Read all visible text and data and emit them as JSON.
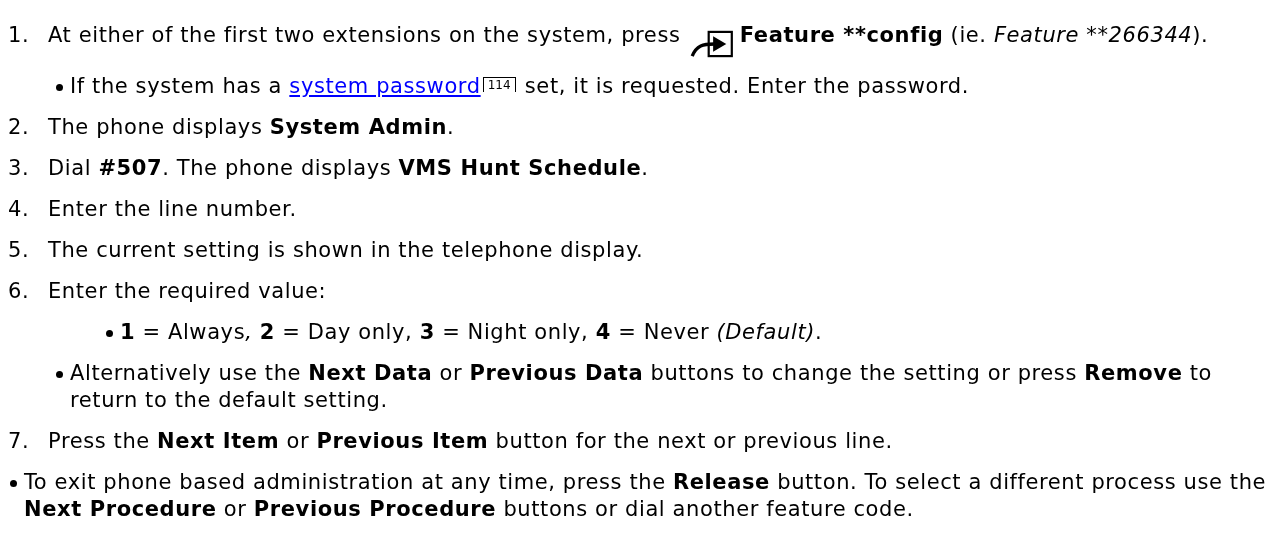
{
  "items": [
    {
      "kind": "step",
      "number": "1.",
      "segments": [
        {
          "kind": "plain",
          "text": "At either of the first two extensions on the system, press "
        },
        {
          "kind": "icon"
        },
        {
          "kind": "bold",
          "text": "Feature **config"
        },
        {
          "kind": "plain",
          "text": " (ie. "
        },
        {
          "kind": "italic",
          "text": "Feature **266344"
        },
        {
          "kind": "plain",
          "text": ")."
        }
      ],
      "children": [
        {
          "kind": "bullet",
          "segments": [
            {
              "kind": "plain",
              "text": "If the system has a "
            },
            {
              "kind": "link",
              "text": "system password"
            },
            {
              "kind": "pageref",
              "text": "114"
            },
            {
              "kind": "plain",
              "text": " set, it is requested. Enter the password."
            }
          ]
        }
      ]
    },
    {
      "kind": "step",
      "number": "2.",
      "segments": [
        {
          "kind": "plain",
          "text": "The phone displays "
        },
        {
          "kind": "bold",
          "text": "System Admin"
        },
        {
          "kind": "plain",
          "text": "."
        }
      ]
    },
    {
      "kind": "step",
      "number": "3.",
      "segments": [
        {
          "kind": "plain",
          "text": "Dial "
        },
        {
          "kind": "bold",
          "text": "#507"
        },
        {
          "kind": "plain",
          "text": ". The phone displays "
        },
        {
          "kind": "bold",
          "text": "VMS Hunt Schedule"
        },
        {
          "kind": "plain",
          "text": "."
        }
      ]
    },
    {
      "kind": "step",
      "number": "4.",
      "segments": [
        {
          "kind": "plain",
          "text": "Enter the line number."
        }
      ]
    },
    {
      "kind": "step",
      "number": "5.",
      "segments": [
        {
          "kind": "plain",
          "text": "The current setting is shown in the telephone display."
        }
      ]
    },
    {
      "kind": "step",
      "number": "6.",
      "segments": [
        {
          "kind": "plain",
          "text": "Enter the required value:"
        }
      ],
      "children": [
        {
          "kind": "group",
          "children": [
            {
              "kind": "bullet",
              "segments": [
                {
                  "kind": "bold",
                  "text": "1"
                },
                {
                  "kind": "plain",
                  "text": " = Always"
                },
                {
                  "kind": "italic",
                  "text": ", "
                },
                {
                  "kind": "bold",
                  "text": "2"
                },
                {
                  "kind": "plain",
                  "text": " = Day only, "
                },
                {
                  "kind": "bold",
                  "text": "3"
                },
                {
                  "kind": "plain",
                  "text": " = Night only, "
                },
                {
                  "kind": "bold",
                  "text": "4"
                },
                {
                  "kind": "plain",
                  "text": " = Never "
                },
                {
                  "kind": "italic",
                  "text": "(Default)"
                },
                {
                  "kind": "plain",
                  "text": "."
                }
              ]
            }
          ]
        },
        {
          "kind": "bullet",
          "segments": [
            {
              "kind": "plain",
              "text": "Alternatively use the "
            },
            {
              "kind": "bold",
              "text": "Next Data"
            },
            {
              "kind": "plain",
              "text": " or "
            },
            {
              "kind": "bold",
              "text": "Previous Data"
            },
            {
              "kind": "plain",
              "text": " buttons to change the setting or press "
            },
            {
              "kind": "bold",
              "text": "Remove"
            },
            {
              "kind": "plain",
              "text": " to return to the default setting."
            }
          ]
        }
      ]
    },
    {
      "kind": "step",
      "number": "7.",
      "segments": [
        {
          "kind": "plain",
          "text": "Press the "
        },
        {
          "kind": "bold",
          "text": "Next Item"
        },
        {
          "kind": "plain",
          "text": " or "
        },
        {
          "kind": "bold",
          "text": "Previous Item"
        },
        {
          "kind": "plain",
          "text": " button for the next or previous line."
        }
      ]
    },
    {
      "kind": "bullet",
      "segments": [
        {
          "kind": "plain",
          "text": "To exit phone based administration at any time, press the "
        },
        {
          "kind": "bold",
          "text": "Release"
        },
        {
          "kind": "plain",
          "text": " button. To select a different process use the "
        },
        {
          "kind": "bold",
          "text": "Next Procedure"
        },
        {
          "kind": "plain",
          "text": " or "
        },
        {
          "kind": "bold",
          "text": "Previous Procedure"
        },
        {
          "kind": "plain",
          "text": " buttons or dial another feature code."
        }
      ]
    }
  ]
}
